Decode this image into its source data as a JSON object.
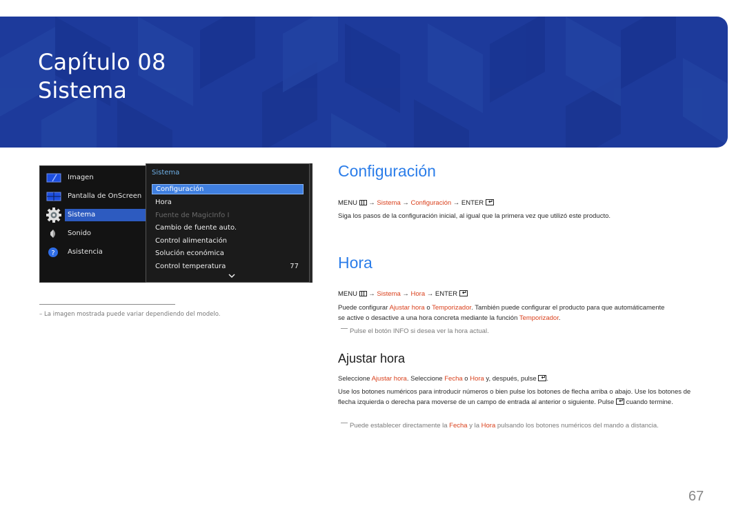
{
  "banner": {
    "chapter": "Capítulo 08",
    "title": "Sistema",
    "color": "#1d3a9b"
  },
  "osd": {
    "left_menu": [
      {
        "label": "Imagen",
        "icon": "picture-icon",
        "active": false
      },
      {
        "label": "Pantalla de OnScreen",
        "icon": "onscreen-display-icon",
        "active": false
      },
      {
        "label": "Sistema",
        "icon": "gear-icon",
        "active": true
      },
      {
        "label": "Sonido",
        "icon": "speaker-icon",
        "active": false
      },
      {
        "label": "Asistencia",
        "icon": "help-icon",
        "active": false
      }
    ],
    "submenu_header": "Sistema",
    "submenu": [
      {
        "label": "Configuración",
        "value": "",
        "state": "selected"
      },
      {
        "label": "Hora",
        "value": "",
        "state": "normal"
      },
      {
        "label": "Fuente de MagicInfo I",
        "value": "",
        "state": "disabled"
      },
      {
        "label": "Cambio de fuente auto.",
        "value": "",
        "state": "normal"
      },
      {
        "label": "Control alimentación",
        "value": "",
        "state": "normal"
      },
      {
        "label": "Solución económica",
        "value": "",
        "state": "normal"
      },
      {
        "label": "Control temperatura",
        "value": "77",
        "state": "normal"
      }
    ],
    "more_icon": "chevron-down-icon"
  },
  "footnote": "–  La imagen mostrada puede variar dependiendo del modelo.",
  "sections": {
    "configuracion": {
      "heading": "Configuración",
      "path": {
        "menu": "MENU",
        "arrow": "→",
        "items": [
          "Sistema",
          "Configuración"
        ],
        "enter": "ENTER"
      },
      "text": "Siga los pasos de la configuración inicial, al igual que la primera vez que utilizó este producto."
    },
    "hora": {
      "heading": "Hora",
      "path": {
        "menu": "MENU",
        "arrow": "→",
        "items": [
          "Sistema",
          "Hora"
        ],
        "enter": "ENTER"
      },
      "text_parts": [
        "Puede configurar ",
        "Ajustar hora",
        " o ",
        "Temporizador",
        ". También puede configurar el producto para que automáticamente se active o desactive a una hora concreta mediante la función ",
        "Temporizador",
        "."
      ],
      "note": "Pulse el botón INFO si desea ver la hora actual."
    },
    "ajustar_hora": {
      "heading": "Ajustar hora",
      "p1_parts": [
        "Seleccione ",
        "Ajustar hora",
        ". Seleccione ",
        "Fecha",
        " o ",
        "Hora",
        " y, después, pulse ",
        "."
      ],
      "p2_parts": [
        "Use los botones numéricos para introducir números o bien pulse los botones de flecha arriba o abajo. Use los botones de flecha izquierda o derecha para moverse de un campo de entrada al anterior o siguiente. Pulse ",
        " cuando termine."
      ],
      "note_parts": [
        "Puede establecer directamente la ",
        "Fecha",
        " y la ",
        "Hora",
        " pulsando los botones numéricos del mando a distancia."
      ]
    }
  },
  "colors": {
    "highlight": "#d9401c",
    "heading": "#2b7de9"
  },
  "page_number": "67"
}
